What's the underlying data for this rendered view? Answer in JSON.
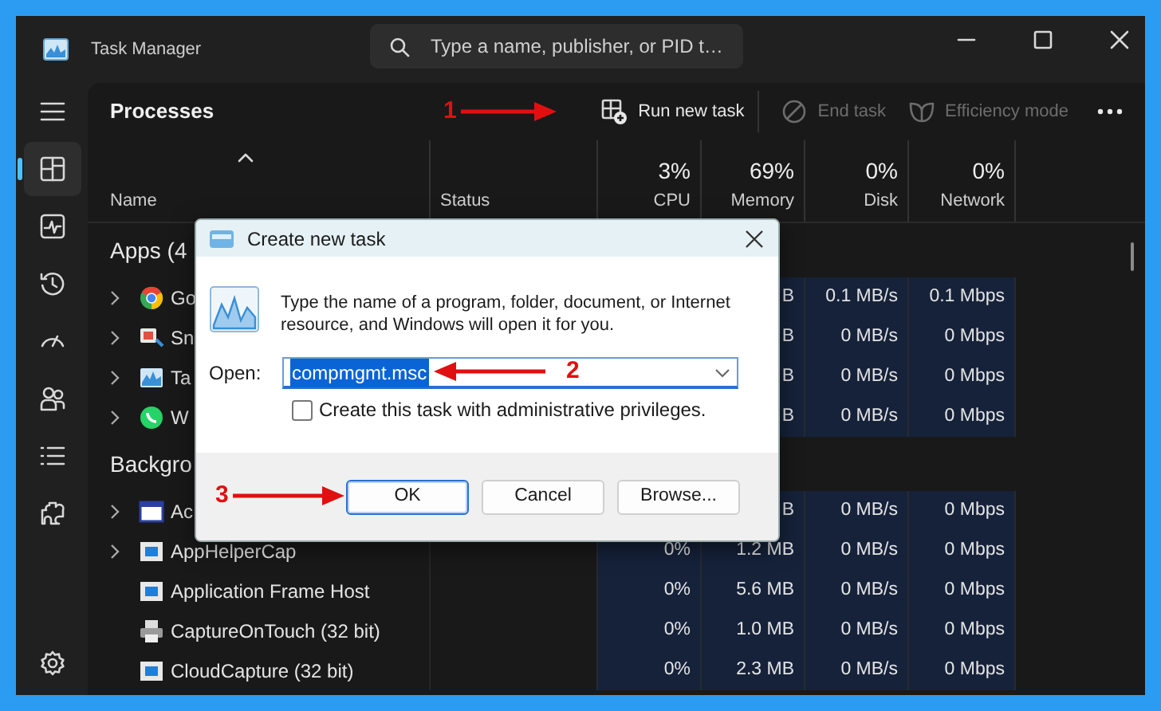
{
  "window": {
    "title": "Task Manager"
  },
  "search": {
    "placeholder": "Type a name, publisher, or PID t…"
  },
  "nav": [
    {
      "selected": true
    },
    {
      "selected": false
    },
    {
      "selected": false
    },
    {
      "selected": false
    },
    {
      "selected": false
    },
    {
      "selected": false
    },
    {
      "selected": false
    }
  ],
  "page": {
    "title": "Processes"
  },
  "toolbar": [
    {
      "label": "Run new task",
      "disabled": false
    },
    {
      "label": "End task",
      "disabled": true
    },
    {
      "label": "Efficiency mode",
      "disabled": true
    }
  ],
  "columns": [
    {
      "label": "Name",
      "sorted": true
    },
    {
      "label": "Status",
      "sorted": false
    },
    {
      "label": "CPU",
      "total": "3%",
      "sorted": false
    },
    {
      "label": "Memory",
      "total": "69%",
      "sorted": false
    },
    {
      "label": "Disk",
      "total": "0%",
      "sorted": false
    },
    {
      "label": "Network",
      "total": "0%",
      "sorted": false
    }
  ],
  "groups": [
    {
      "title": "Apps (4",
      "rows": [
        {
          "name": "Go",
          "expandable": true,
          "memory": "B",
          "disk": "0.1 MB/s",
          "network": "0.1 Mbps"
        },
        {
          "name": "Sn",
          "expandable": true,
          "memory": "B",
          "disk": "0 MB/s",
          "network": "0 Mbps"
        },
        {
          "name": "Ta",
          "expandable": true,
          "memory": "B",
          "disk": "0 MB/s",
          "network": "0 Mbps"
        },
        {
          "name": "W",
          "expandable": true,
          "memory": "B",
          "disk": "0 MB/s",
          "network": "0 Mbps"
        }
      ]
    },
    {
      "title": "Backgro",
      "rows": [
        {
          "name": "Ac",
          "expandable": true,
          "memory": "B",
          "disk": "0 MB/s",
          "network": "0 Mbps"
        },
        {
          "name": "AppHelperCap",
          "expandable": true,
          "cpu": "0%",
          "memory": "1.2 MB",
          "disk": "0 MB/s",
          "network": "0 Mbps"
        },
        {
          "name": "Application Frame Host",
          "expandable": false,
          "cpu": "0%",
          "memory": "5.6 MB",
          "disk": "0 MB/s",
          "network": "0 Mbps"
        },
        {
          "name": "CaptureOnTouch (32 bit)",
          "expandable": false,
          "cpu": "0%",
          "memory": "1.0 MB",
          "disk": "0 MB/s",
          "network": "0 Mbps"
        },
        {
          "name": "CloudCapture (32 bit)",
          "expandable": false,
          "cpu": "0%",
          "memory": "2.3 MB",
          "disk": "0 MB/s",
          "network": "0 Mbps"
        }
      ]
    }
  ],
  "dialog": {
    "title": "Create new task",
    "message": "Type the name of a program, folder, document, or Internet resource, and Windows will open it for you.",
    "open_label": "Open:",
    "open_field": {
      "value": "compmgmt.msc",
      "selected": true
    },
    "admin_checkbox": {
      "label": "Create this task with administrative privileges.",
      "checked": false
    },
    "buttons": [
      {
        "label": "OK",
        "focused": true
      },
      {
        "label": "Cancel",
        "focused": false
      },
      {
        "label": "Browse...",
        "focused": false
      }
    ]
  },
  "annotations": [
    {
      "label": "1"
    },
    {
      "label": "2"
    },
    {
      "label": "3"
    }
  ]
}
